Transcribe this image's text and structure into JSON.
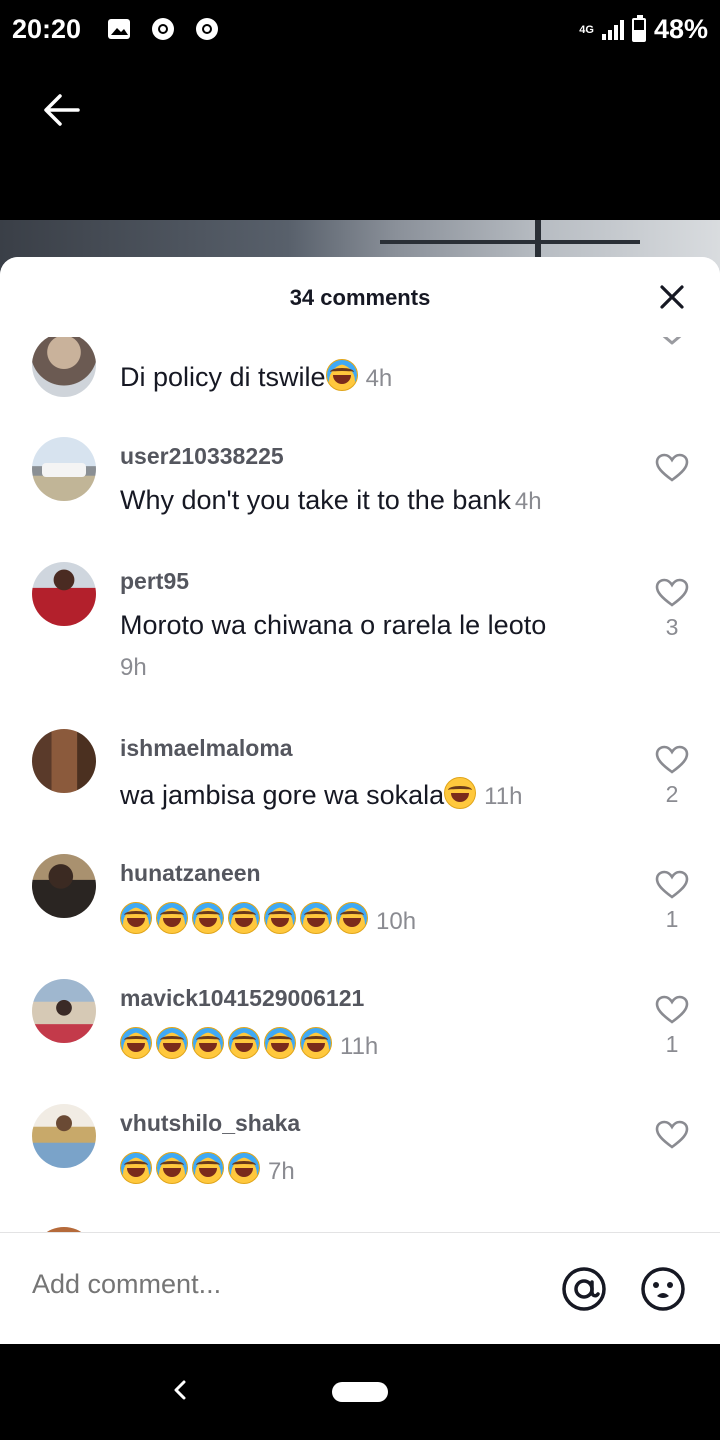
{
  "status_bar": {
    "time": "20:20",
    "network_label": "4G",
    "battery_percent": "48%",
    "battery_level": 0.48
  },
  "sheet": {
    "title": "34 comments",
    "close_icon": "close-icon"
  },
  "comments": [
    {
      "username": "",
      "text": "Di policy di tswile",
      "emoji": [
        "tears-of-joy"
      ],
      "time": "4h",
      "likes": ""
    },
    {
      "username": "user210338225",
      "text": "Why don't you take it to the bank",
      "emoji": [],
      "time": "4h",
      "likes": ""
    },
    {
      "username": "pert95",
      "text": "Moroto wa chiwana o rarela le leoto",
      "emoji": [],
      "time": "9h",
      "likes": "3"
    },
    {
      "username": "ishmaelmaloma",
      "text": "wa jambisa gore wa sokala",
      "emoji": [
        "grinning-sweat"
      ],
      "time": "11h",
      "likes": "2"
    },
    {
      "username": "hunatzaneen",
      "text": "",
      "emoji": [
        "tears-of-joy",
        "tears-of-joy",
        "tears-of-joy",
        "tears-of-joy",
        "tears-of-joy",
        "tears-of-joy",
        "tears-of-joy"
      ],
      "time": "10h",
      "likes": "1"
    },
    {
      "username": "mavick1041529006121",
      "text": "",
      "emoji": [
        "tears-of-joy",
        "tears-of-joy",
        "tears-of-joy",
        "tears-of-joy",
        "tears-of-joy",
        "tears-of-joy"
      ],
      "time": "11h",
      "likes": "1"
    },
    {
      "username": "vhutshilo_shaka",
      "text": "",
      "emoji": [
        "tears-of-joy",
        "tears-of-joy",
        "tears-of-joy",
        "tears-of-joy"
      ],
      "time": "7h",
      "likes": ""
    }
  ],
  "composer": {
    "placeholder": "Add comment..."
  },
  "icons": {
    "like": "heart-outline-icon",
    "mention": "at-sign-icon",
    "emoji_picker": "smiley-icon",
    "back": "arrow-left-icon"
  },
  "colors": {
    "sheet_bg": "#ffffff",
    "text_primary": "#161823",
    "text_secondary": "#8a8b91",
    "status_bg": "#000000"
  }
}
